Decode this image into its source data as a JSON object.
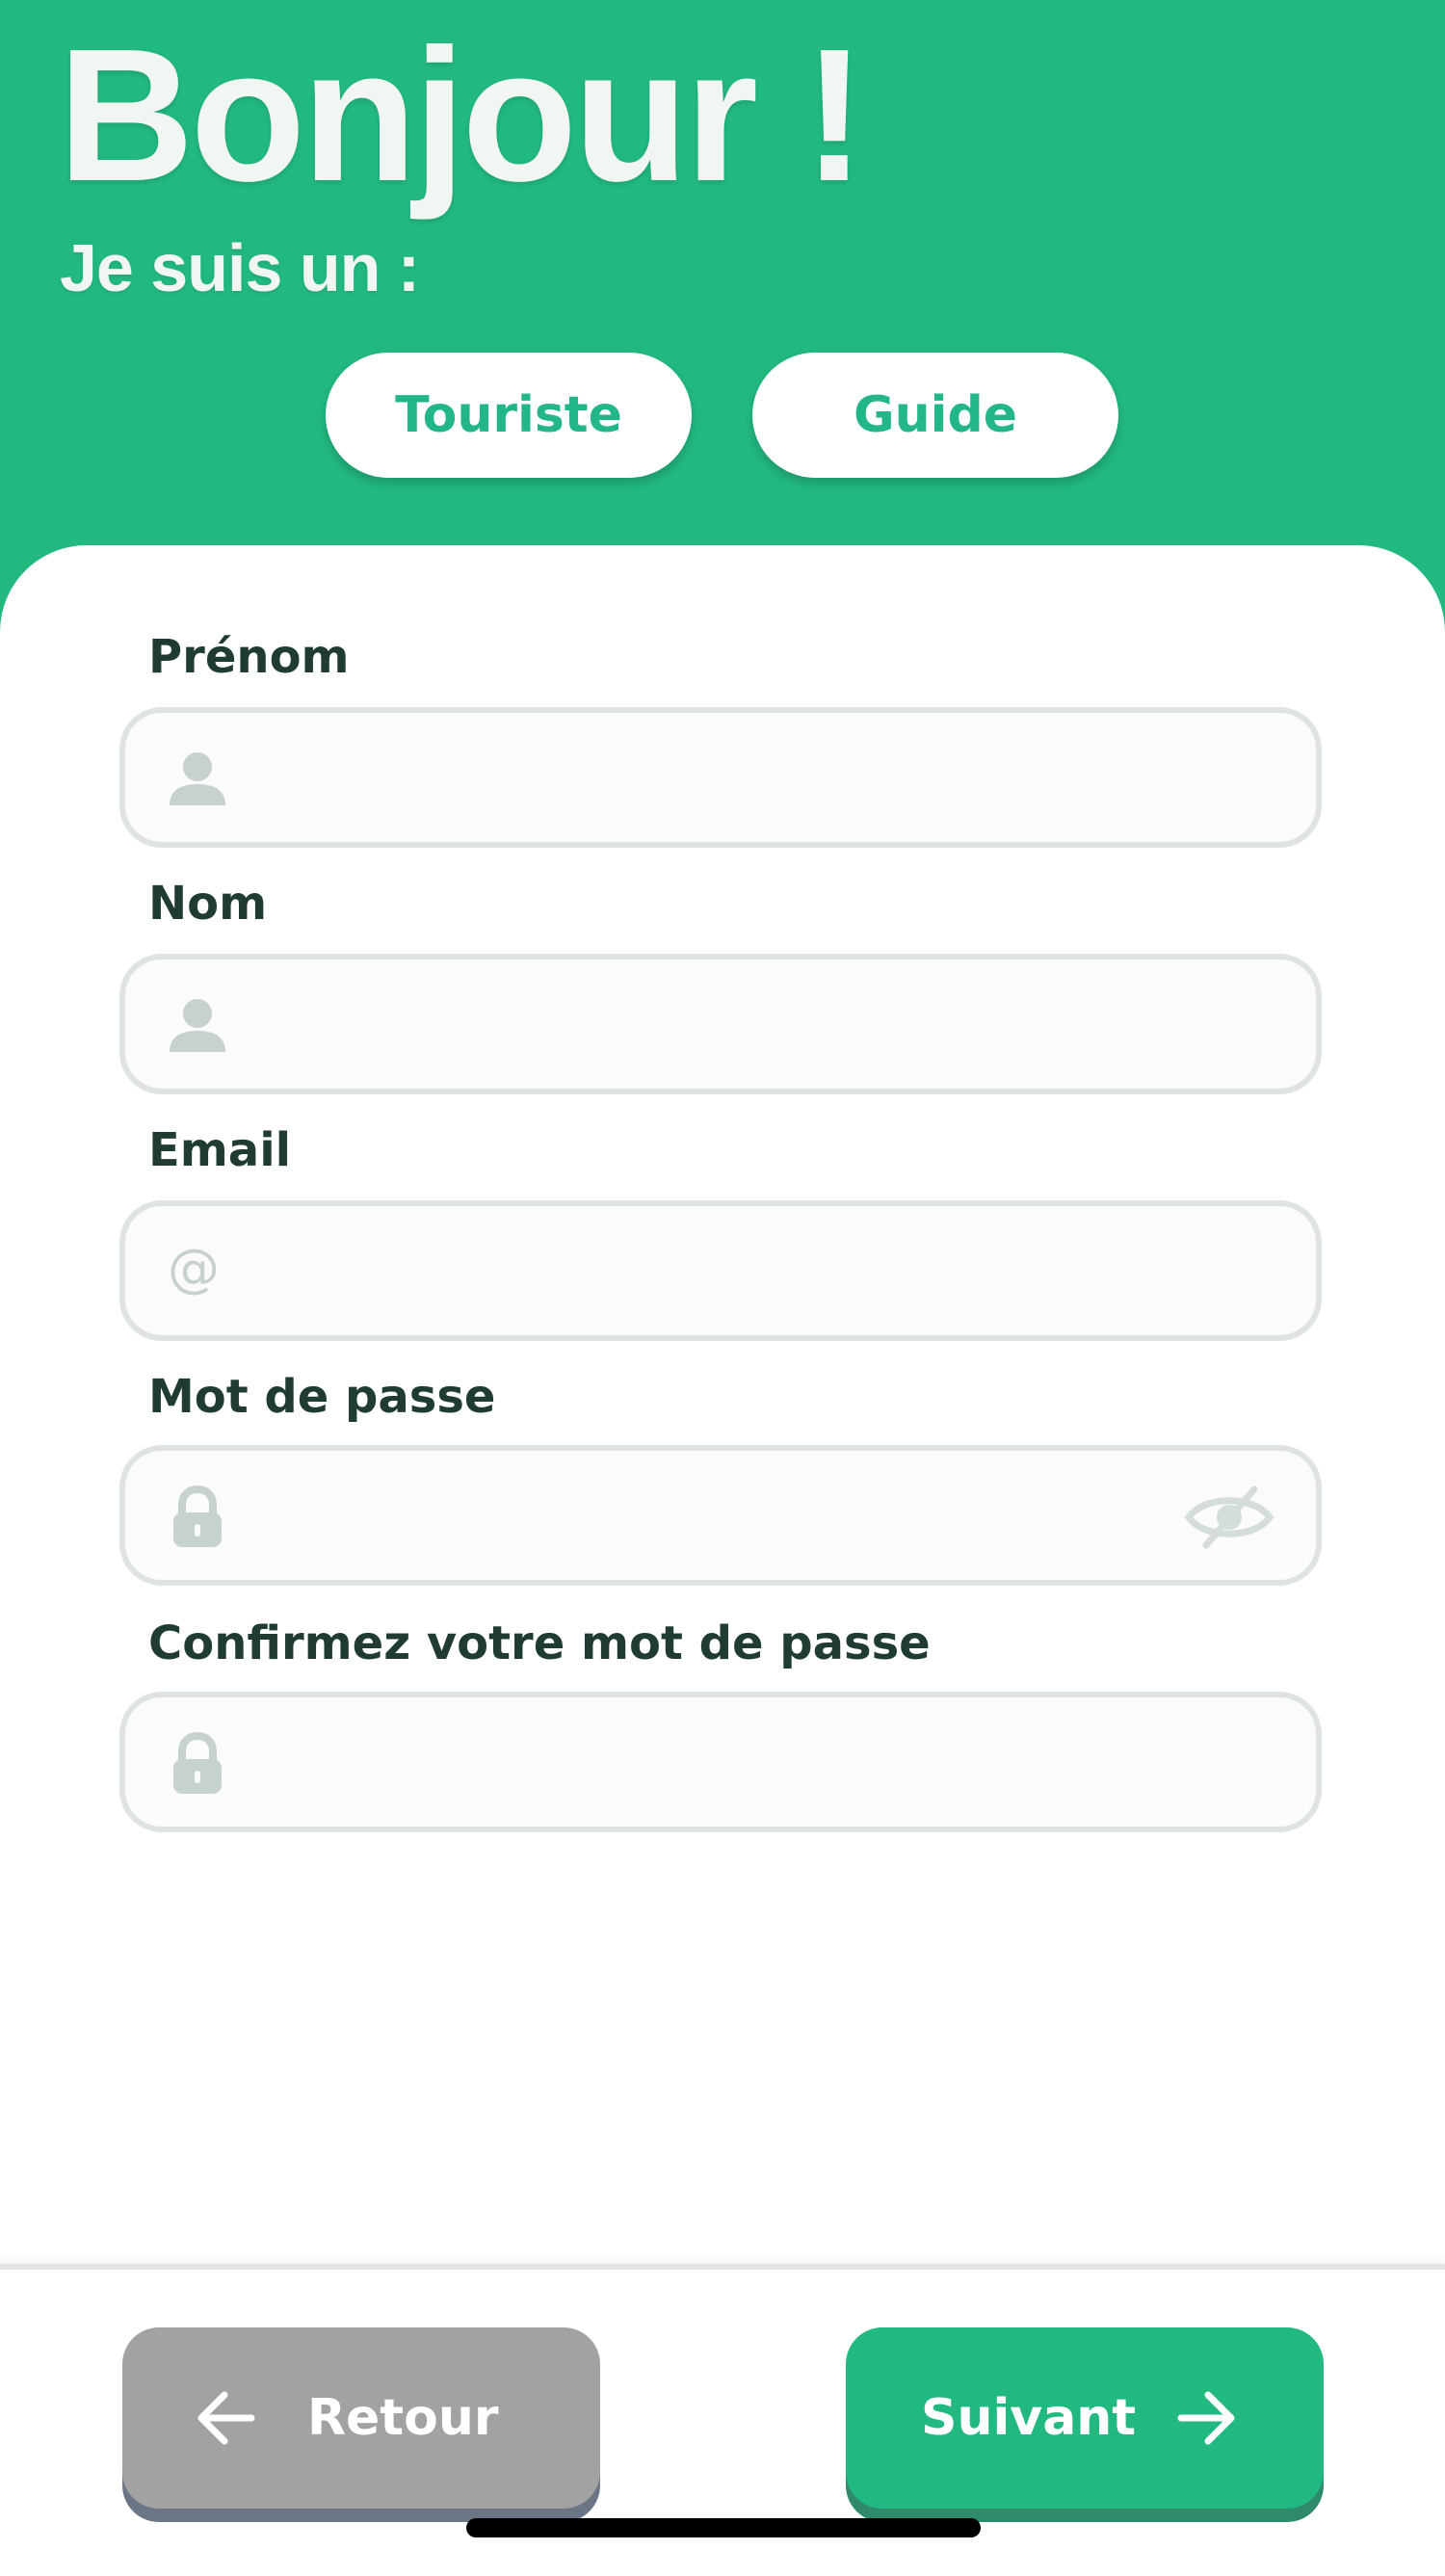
{
  "header": {
    "greeting": "Bonjour !",
    "subtitle": "Je suis un :",
    "roles": [
      {
        "label": "Touriste"
      },
      {
        "label": "Guide"
      }
    ]
  },
  "form": {
    "fields": [
      {
        "label": "Prénom",
        "value": "",
        "icon": "person-icon"
      },
      {
        "label": "Nom",
        "value": "",
        "icon": "person-icon"
      },
      {
        "label": "Email",
        "value": "",
        "icon": "at-icon",
        "icon_glyph": "@"
      },
      {
        "label": "Mot de passe",
        "value": "",
        "icon": "lock-icon",
        "toggle_icon": "eye-slash-icon"
      },
      {
        "label": "Confirmez votre mot de passe",
        "value": "",
        "icon": "lock-icon"
      }
    ]
  },
  "footer": {
    "back_label": "Retour",
    "next_label": "Suivant"
  },
  "colors": {
    "accent": "#22b980",
    "back_button": "#a2a2a2",
    "field_border": "#dde4e1",
    "label_text": "#1f3b34"
  }
}
